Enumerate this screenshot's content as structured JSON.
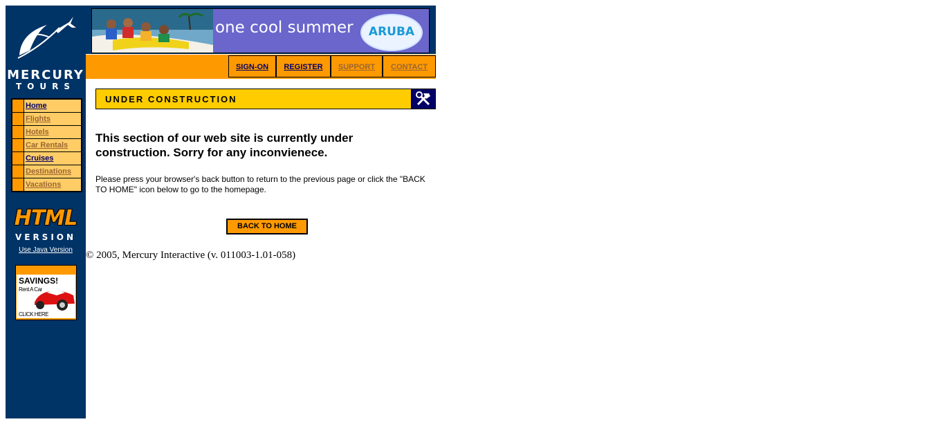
{
  "brand": {
    "logo_line1": "MERCURY",
    "logo_line2": "TOURS"
  },
  "sidebar": {
    "items": [
      {
        "label": "Home",
        "state": "active"
      },
      {
        "label": "Flights",
        "state": "dim"
      },
      {
        "label": "Hotels",
        "state": "dim"
      },
      {
        "label": "Car Rentals",
        "state": "dim"
      },
      {
        "label": "Cruises",
        "state": "active"
      },
      {
        "label": "Destinations",
        "state": "dim"
      },
      {
        "label": "Vacations",
        "state": "dim"
      }
    ],
    "html_badge_word": "HTML",
    "html_badge_version": "VERSION",
    "java_link": "Use Java Version",
    "ad": {
      "title": "SAVINGS!",
      "subtitle": "Rent A Car",
      "cta": "CLICK HERE"
    }
  },
  "banner": {
    "text": "one cool summer",
    "logo": "ARUBA"
  },
  "topnav": {
    "signon": "SIGN-ON",
    "register": "REGISTER",
    "support": "SUPPORT",
    "contact": "CONTACT"
  },
  "main": {
    "section_title": "UNDER CONSTRUCTION",
    "heading": "This section of our web site is currently under construction.   Sorry for any inconvienece.",
    "body": "Please press your browser's back button to return to the previous page or click the \"BACK TO HOME\" icon below to go to the homepage.",
    "back_button": "BACK TO HOME"
  },
  "footer": {
    "copyright": "© 2005, Mercury Interactive (v. 011003-1.01-058)"
  },
  "colors": {
    "sidebar_bg": "#003366",
    "accent_orange": "#ff9900",
    "nav_cell": "#ffcc66",
    "uc_yellow": "#ffcc00",
    "link_dark": "#000066"
  },
  "icons": {
    "logo": "airplane-swoosh-icon",
    "construction": "hammer-wrench-icon",
    "ad": "red-car-icon"
  }
}
